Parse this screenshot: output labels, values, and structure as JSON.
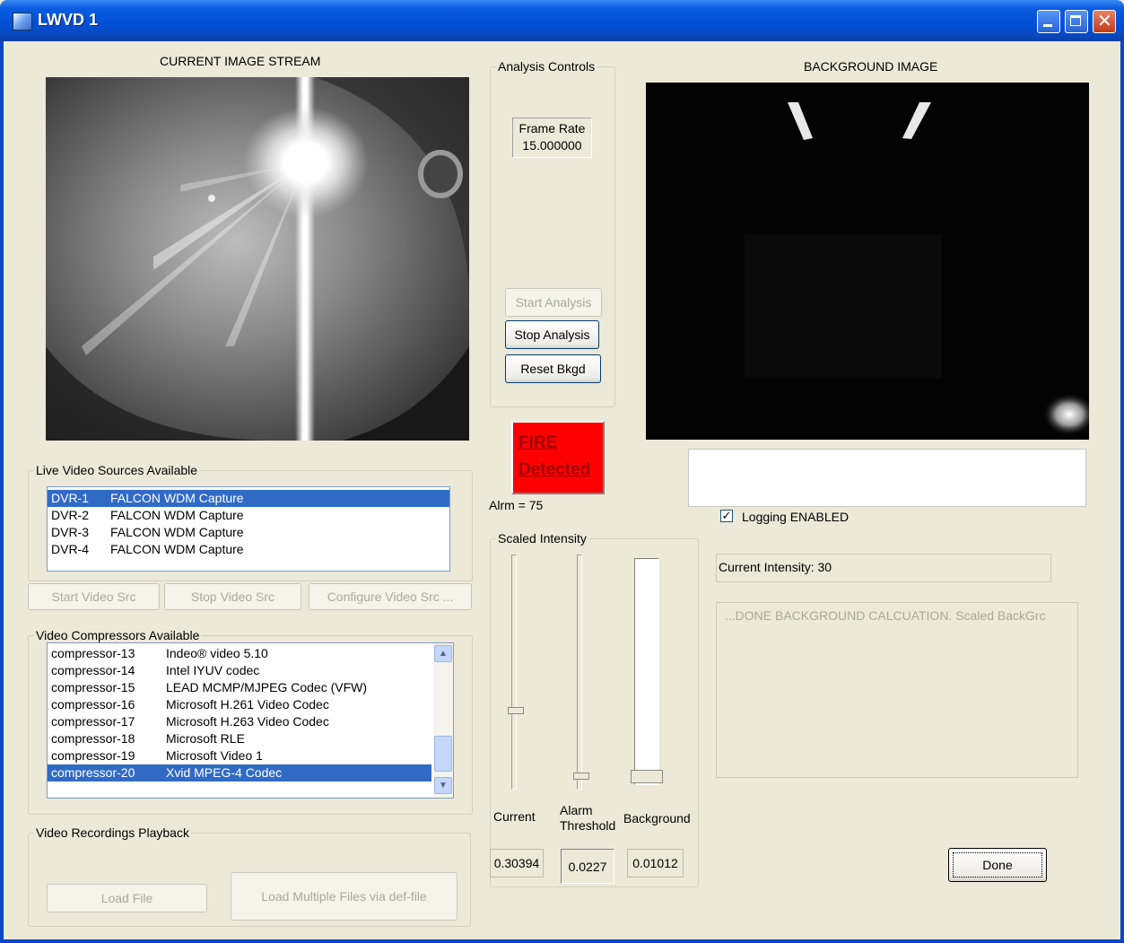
{
  "window": {
    "title": "LWVD 1"
  },
  "stream": {
    "heading": "CURRENT IMAGE STREAM"
  },
  "analysis": {
    "group_label": "Analysis Controls",
    "frame_rate_label": "Frame Rate",
    "frame_rate_value": "15.000000",
    "start_label": "Start Analysis",
    "stop_label": "Stop Analysis",
    "reset_label": "Reset Bkgd"
  },
  "background": {
    "heading": "BACKGROUND IMAGE"
  },
  "fire": {
    "line1": "FIRE",
    "line2": "Detected",
    "alarm": "Alrm = 75"
  },
  "logging": {
    "label": "Logging ENABLED",
    "checked": true
  },
  "intensity_status": "Current Intensity: 30",
  "message_log": "...DONE BACKGROUND CALCUATION.  Scaled BackGrc",
  "live_sources": {
    "group_label": "Live Video Sources Available",
    "items": [
      {
        "id": "DVR-1",
        "name": "FALCON WDM Capture",
        "selected": true
      },
      {
        "id": "DVR-2",
        "name": "FALCON WDM Capture",
        "selected": false
      },
      {
        "id": "DVR-3",
        "name": "FALCON WDM Capture",
        "selected": false
      },
      {
        "id": "DVR-4",
        "name": "FALCON WDM Capture",
        "selected": false
      }
    ],
    "start_label": "Start Video Src",
    "stop_label": "Stop Video Src",
    "configure_label": "Configure Video Src ..."
  },
  "compressors": {
    "group_label": "Video Compressors Available",
    "items": [
      {
        "id": "compressor-13",
        "name": "Indeo® video 5.10",
        "selected": false
      },
      {
        "id": "compressor-14",
        "name": "Intel IYUV codec",
        "selected": false
      },
      {
        "id": "compressor-15",
        "name": "LEAD MCMP/MJPEG Codec (VFW)",
        "selected": false
      },
      {
        "id": "compressor-16",
        "name": "Microsoft H.261 Video Codec",
        "selected": false
      },
      {
        "id": "compressor-17",
        "name": "Microsoft H.263 Video Codec",
        "selected": false
      },
      {
        "id": "compressor-18",
        "name": "Microsoft RLE",
        "selected": false
      },
      {
        "id": "compressor-19",
        "name": "Microsoft Video 1",
        "selected": false
      },
      {
        "id": "compressor-20",
        "name": "Xvid MPEG-4 Codec",
        "selected": true
      }
    ]
  },
  "playback": {
    "group_label": "Video Recordings Playback",
    "load_file_label": "Load File",
    "load_multiple_label": "Load Multiple Files via def-file"
  },
  "scaled_intensity": {
    "group_label": "Scaled Intensity",
    "current_label": "Current",
    "alarm_label_line1": "Alarm",
    "alarm_label_line2": "Threshold",
    "background_label": "Background",
    "current_value": "0.30394",
    "alarm_value": "0.0227",
    "background_value": "0.01012",
    "current_slider_level": 0.68,
    "alarm_slider_level": 0.97
  },
  "done_label": "Done",
  "colors": {
    "titlebar": "#0054e3",
    "selection": "#316ac5",
    "alarm": "#ff0000",
    "face": "#ece9d8"
  }
}
